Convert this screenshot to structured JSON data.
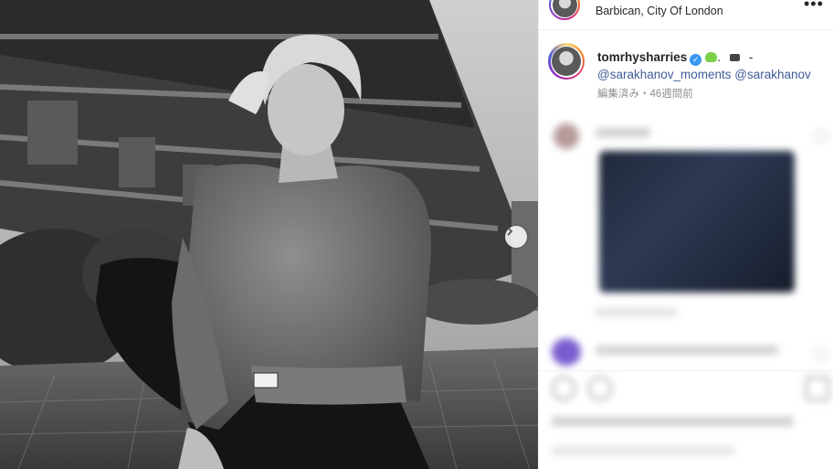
{
  "post": {
    "location": "Barbican, City Of London",
    "more_icon": "more-dots-icon",
    "next_icon": "chevron-right-icon"
  },
  "caption": {
    "username": "tomrhysharries",
    "verified_icon": "verified-badge-icon",
    "emoji_tail": ".",
    "dash": "-",
    "mention_1": "@sarakhanov_moments",
    "mention_2": "@sarakhanov",
    "meta": "編集済み・46週間前"
  },
  "colors": {
    "accent_link": "#3f5c9a",
    "verified": "#3897f0",
    "muted": "#8e8e8e"
  }
}
